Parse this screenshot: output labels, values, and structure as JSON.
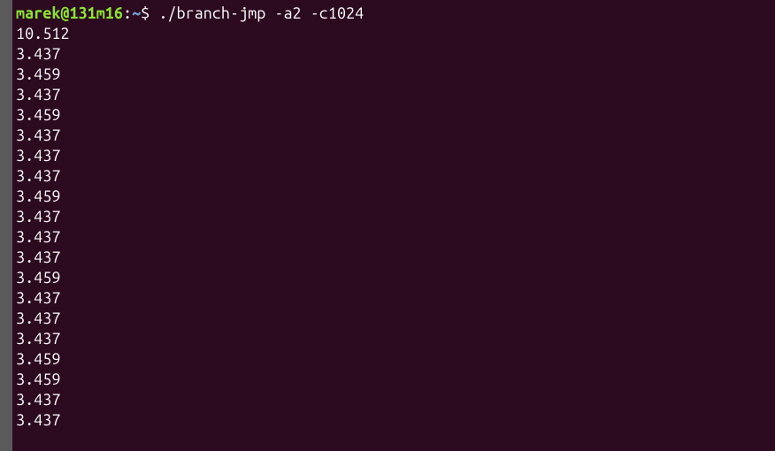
{
  "prompt": {
    "user_host": "marek@131m16",
    "separator": ":",
    "path": "~",
    "symbol": "$",
    "command": "./branch-jmp -a2 -c1024"
  },
  "output_lines": [
    "10.512",
    "3.437",
    "3.459",
    "3.437",
    "3.459",
    "3.437",
    "3.437",
    "3.437",
    "3.459",
    "3.437",
    "3.437",
    "3.437",
    "3.459",
    "3.437",
    "3.437",
    "3.437",
    "3.459",
    "3.459",
    "3.437",
    "3.437"
  ]
}
